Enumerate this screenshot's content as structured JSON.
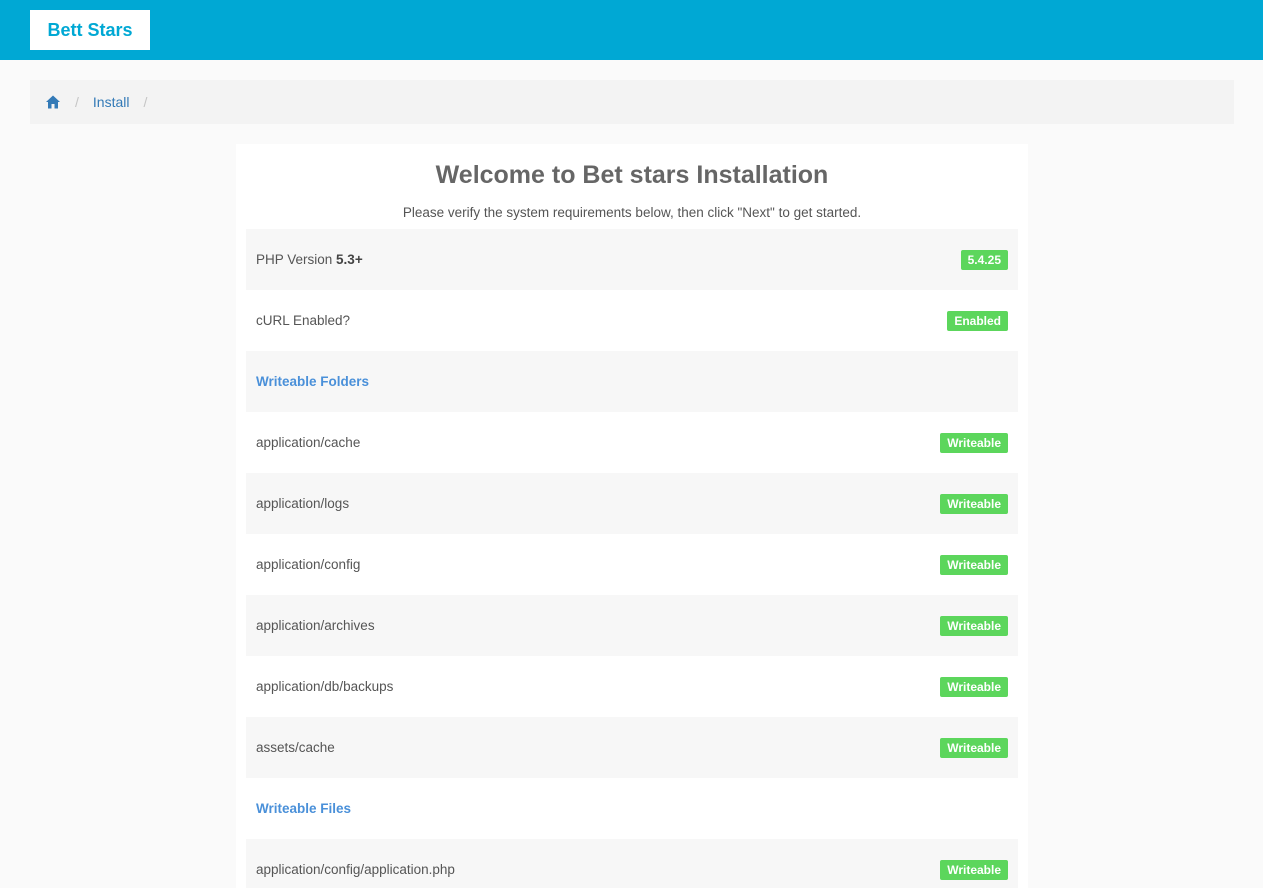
{
  "brand": "Bett Stars",
  "breadcrumb": {
    "home_icon": "home-icon",
    "separator": "/",
    "items": [
      "Install"
    ]
  },
  "main": {
    "title": "Welcome to Bet stars Installation",
    "subtitle": "Please verify the system requirements below, then click \"Next\" to get started."
  },
  "requirements": [
    {
      "type": "item",
      "label": "PHP Version ",
      "label_strong": "5.3+",
      "status": "5.4.25"
    },
    {
      "type": "item",
      "label": "cURL Enabled?",
      "status": "Enabled"
    },
    {
      "type": "section",
      "label": "Writeable Folders"
    },
    {
      "type": "item",
      "label": "application/cache",
      "status": "Writeable"
    },
    {
      "type": "item",
      "label": "application/logs",
      "status": "Writeable"
    },
    {
      "type": "item",
      "label": "application/config",
      "status": "Writeable"
    },
    {
      "type": "item",
      "label": "application/archives",
      "status": "Writeable"
    },
    {
      "type": "item",
      "label": "application/db/backups",
      "status": "Writeable"
    },
    {
      "type": "item",
      "label": "assets/cache",
      "status": "Writeable"
    },
    {
      "type": "section",
      "label": "Writeable Files"
    },
    {
      "type": "item",
      "label": "application/config/application.php",
      "status": "Writeable"
    }
  ],
  "colors": {
    "topbar": "#00a8d4",
    "success": "#5cd65c",
    "link": "#337ab7",
    "section": "#4a90d9"
  }
}
